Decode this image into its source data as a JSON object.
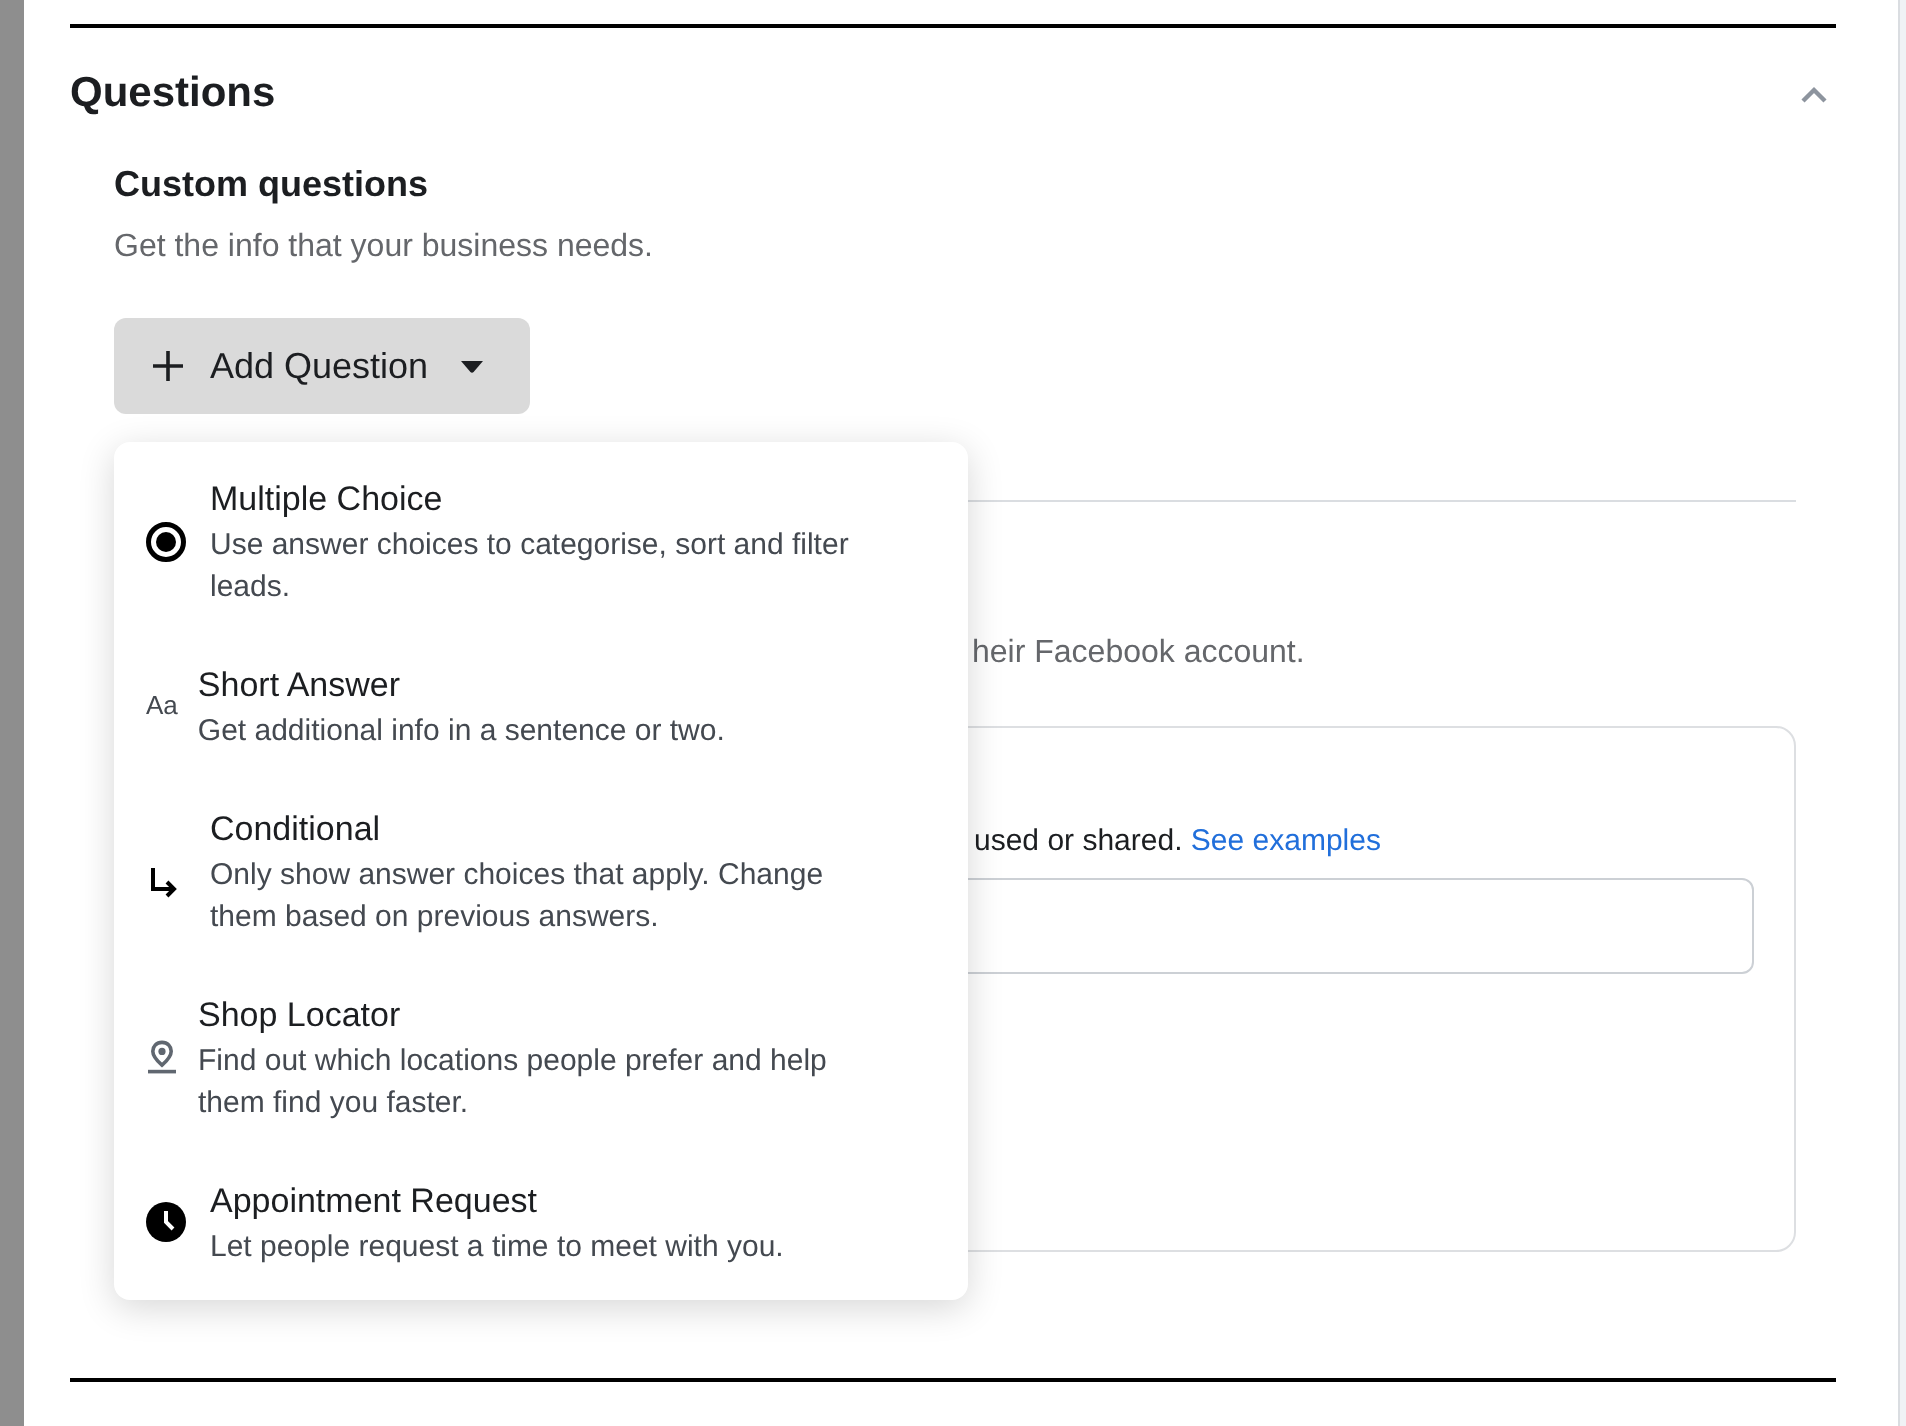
{
  "section": {
    "title": "Questions",
    "expanded": true
  },
  "custom_questions": {
    "title": "Custom questions",
    "description": "Get the info that your business needs.",
    "add_button": {
      "label": "Add Question",
      "menu_open": true
    }
  },
  "question_menu": [
    {
      "kind": "radio",
      "title": "Multiple Choice",
      "description": "Use answer choices to categorise, sort and filter leads."
    },
    {
      "kind": "text",
      "icon_text": "Aa",
      "title": "Short Answer",
      "description": "Get additional info in a sentence or two."
    },
    {
      "kind": "branch",
      "title": "Conditional",
      "description": "Only show answer choices that apply. Change them based on previous answers."
    },
    {
      "kind": "pin",
      "title": "Shop Locator",
      "description": "Find out which locations people prefer and help them find you faster."
    },
    {
      "kind": "clock",
      "title": "Appointment Request",
      "description": "Let people request a time to meet with you."
    }
  ],
  "next_section": {
    "text": "heir Facebook account.",
    "card": {
      "text": "used or shared.",
      "link": "See examples"
    }
  }
}
